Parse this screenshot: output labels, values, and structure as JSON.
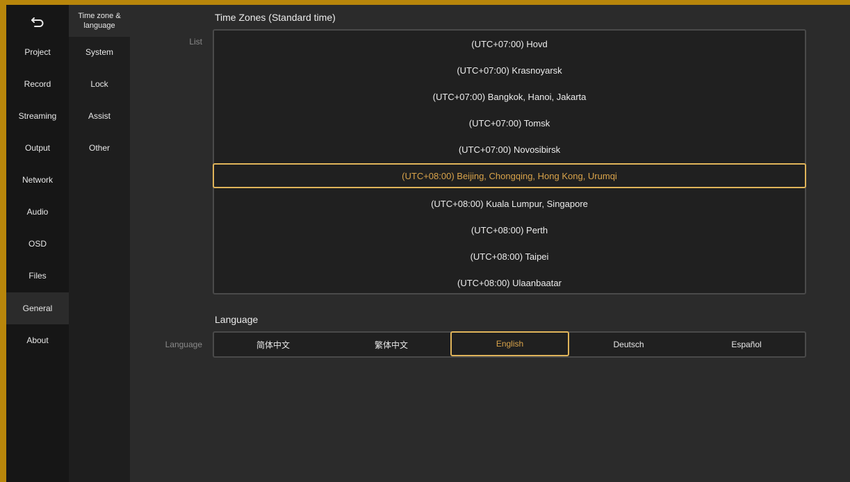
{
  "sidebar": {
    "back_icon": "back-arrow-icon",
    "items": [
      {
        "label": "Project"
      },
      {
        "label": "Record"
      },
      {
        "label": "Streaming"
      },
      {
        "label": "Output"
      },
      {
        "label": "Network"
      },
      {
        "label": "Audio"
      },
      {
        "label": "OSD"
      },
      {
        "label": "Files"
      },
      {
        "label": "General",
        "active": true
      },
      {
        "label": "About"
      }
    ]
  },
  "subnav": {
    "items": [
      {
        "label": "Time zone & language",
        "active": true
      },
      {
        "label": "System"
      },
      {
        "label": "Lock"
      },
      {
        "label": "Assist"
      },
      {
        "label": "Other"
      }
    ]
  },
  "timezones": {
    "title": "Time Zones (Standard time)",
    "row_label": "List",
    "items": [
      "(UTC+07:00) Hovd",
      "(UTC+07:00) Krasnoyarsk",
      "(UTC+07:00) Bangkok, Hanoi, Jakarta",
      "(UTC+07:00) Tomsk",
      "(UTC+07:00) Novosibirsk",
      "(UTC+08:00) Beijing, Chongqing, Hong Kong, Urumqi",
      "(UTC+08:00) Kuala Lumpur, Singapore",
      "(UTC+08:00) Perth",
      "(UTC+08:00) Taipei",
      "(UTC+08:00) Ulaanbaatar"
    ],
    "selected": "(UTC+08:00) Beijing, Chongqing, Hong Kong, Urumqi"
  },
  "language": {
    "title": "Language",
    "row_label": "Language",
    "options": [
      "简体中文",
      "繁体中文",
      "English",
      "Deutsch",
      "Español"
    ],
    "selected": "English"
  },
  "colors": {
    "accent": "#e0b45a",
    "frame": "#b8860b",
    "background": "#2b2b2b",
    "sidebar": "#161616"
  }
}
